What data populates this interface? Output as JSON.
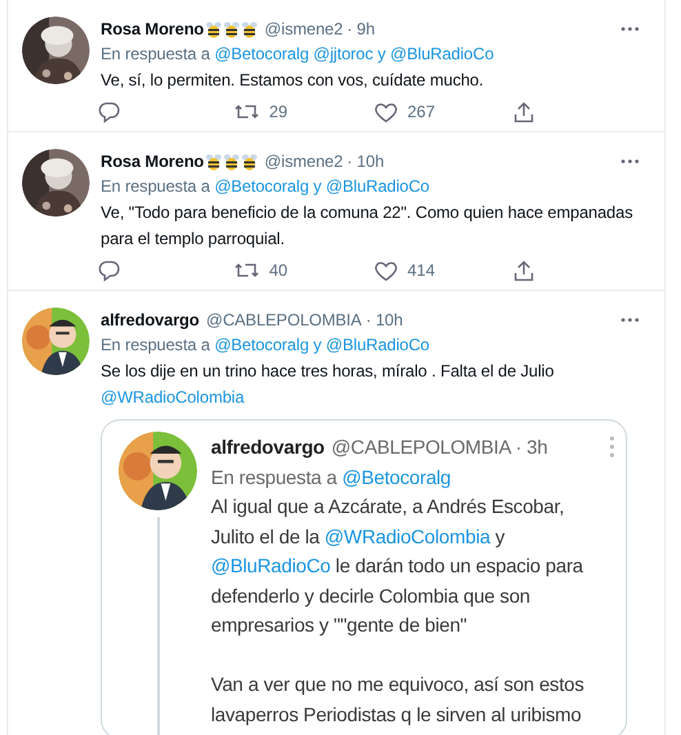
{
  "tweets": [
    {
      "name": "Rosa Moreno",
      "name_icons": [
        {
          "kind": "bee"
        },
        {
          "kind": "bee"
        },
        {
          "kind": "bee"
        }
      ],
      "handle": "@ismene2",
      "time": "· 9h",
      "reply": [
        {
          "kind": "plain",
          "text": "En respuesta a"
        },
        {
          "kind": "link",
          "text": "@Betocoralg"
        },
        {
          "kind": "link",
          "text": "@jjtoroc"
        },
        {
          "kind": "accent",
          "text": "y"
        },
        {
          "kind": "link",
          "text": "@BluRadioCo"
        }
      ],
      "body": [
        {
          "kind": "plain",
          "text": "Ve, sí, lo permiten. Estamos con vos, cuídate mucho."
        }
      ],
      "actions": [
        {
          "kind": "reply"
        },
        {
          "kind": "retweet",
          "count": "29"
        },
        {
          "kind": "like",
          "count": "267"
        },
        {
          "kind": "share"
        }
      ]
    },
    {
      "name": "Rosa Moreno",
      "name_icons": [
        {
          "kind": "bee"
        },
        {
          "kind": "bee"
        },
        {
          "kind": "bee"
        }
      ],
      "handle": "@ismene2",
      "time": "· 10h",
      "reply": [
        {
          "kind": "plain",
          "text": "En respuesta a"
        },
        {
          "kind": "link",
          "text": "@Betocoralg"
        },
        {
          "kind": "accent",
          "text": "y"
        },
        {
          "kind": "link",
          "text": "@BluRadioCo"
        }
      ],
      "body": [
        {
          "kind": "plain",
          "text": "Ve, \"Todo para beneficio de la comuna 22\". Como quien hace empanadas para el templo parroquial."
        }
      ],
      "actions": [
        {
          "kind": "reply"
        },
        {
          "kind": "retweet",
          "count": "40"
        },
        {
          "kind": "like",
          "count": "414"
        },
        {
          "kind": "share"
        }
      ]
    },
    {
      "name": "alfredovargo",
      "handle": "@CABLEPOLOMBIA",
      "time": "· 10h",
      "reply": [
        {
          "kind": "plain",
          "text": "En respuesta a"
        },
        {
          "kind": "link",
          "text": "@Betocoralg"
        },
        {
          "kind": "accent",
          "text": "y"
        },
        {
          "kind": "link",
          "text": "@BluRadioCo"
        }
      ],
      "body": [
        {
          "kind": "plain",
          "text": "Se los dije en un trino hace tres horas, míralo . Falta el de Julio"
        },
        {
          "kind": "break"
        },
        {
          "kind": "link",
          "text": "@WRadioColombia"
        }
      ],
      "screenshot": {
        "name": "alfredovargo",
        "handle": "@CABLEPOLOMBIA",
        "time": "· 3h",
        "reply": [
          {
            "kind": "plain",
            "text": "En respuesta a"
          },
          {
            "kind": "link",
            "text": "@Betocoralg"
          }
        ],
        "paragraphs": [
          [
            {
              "kind": "plain",
              "text": "Al igual que a Azcárate, a Andrés Escobar,"
            },
            {
              "kind": "break"
            },
            {
              "kind": "plain",
              "text": "Julito el de la"
            },
            {
              "kind": "link",
              "text": "@WRadioColombia"
            },
            {
              "kind": "plain",
              "text": "y"
            },
            {
              "kind": "break"
            },
            {
              "kind": "link",
              "text": "@BluRadioCo"
            },
            {
              "kind": "plain",
              "text": " le darán todo un espacio para"
            },
            {
              "kind": "break"
            },
            {
              "kind": "plain",
              "text": "defenderlo y decirle Colombia que son"
            },
            {
              "kind": "break"
            },
            {
              "kind": "plain",
              "text": "empresarios y \"\"gente de bien\""
            }
          ],
          [
            {
              "kind": "plain",
              "text": "Van a ver que no me equivoco, así son estos"
            },
            {
              "kind": "break"
            },
            {
              "kind": "plain",
              "text": "lavaperros Periodistas q le sirven al uribismo"
            }
          ]
        ]
      }
    }
  ]
}
